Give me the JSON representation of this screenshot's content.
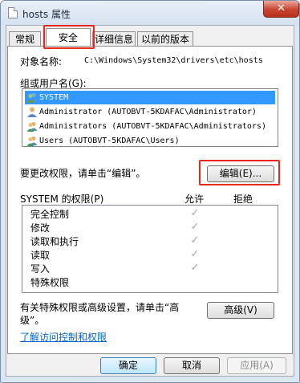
{
  "window": {
    "title": "hosts 属性",
    "close_glyph": "✕"
  },
  "tabs": [
    {
      "label": "常规"
    },
    {
      "label": "安全"
    },
    {
      "label": "详细信息"
    },
    {
      "label": "以前的版本"
    }
  ],
  "object": {
    "label": "对象名称:",
    "value": "C:\\Windows\\System32\\drivers\\etc\\hosts"
  },
  "groups": {
    "label": "组或用户名(G):",
    "items": [
      {
        "name": "SYSTEM",
        "icon": "user-group-icon",
        "selected": true
      },
      {
        "name": "Administrator (AUTOBVT-5KDAFAC\\Administrator)",
        "icon": "user-icon",
        "selected": false
      },
      {
        "name": "Administrators (AUTOBVT-5KDAFAC\\Administrators)",
        "icon": "user-group-icon",
        "selected": false
      },
      {
        "name": "Users (AUTOBVT-5KDAFAC\\Users)",
        "icon": "user-group-icon",
        "selected": false
      }
    ]
  },
  "change_hint": "要更改权限，请单击“编辑”。",
  "edit_button": "编辑(E)...",
  "permissions": {
    "label": "SYSTEM 的权限(P)",
    "allow_header": "允许",
    "deny_header": "拒绝",
    "rows": [
      {
        "name": "完全控制",
        "allow": true,
        "deny": false
      },
      {
        "name": "修改",
        "allow": true,
        "deny": false
      },
      {
        "name": "读取和执行",
        "allow": true,
        "deny": false
      },
      {
        "name": "读取",
        "allow": true,
        "deny": false
      },
      {
        "name": "写入",
        "allow": true,
        "deny": false
      },
      {
        "name": "特殊权限",
        "allow": false,
        "deny": false
      }
    ],
    "check_glyph": "✓"
  },
  "advanced_hint_line1": "有关特殊权限或高级设置，请单击“高",
  "advanced_hint_line2": "级”。",
  "advanced_button": "高级(V)",
  "learn_link": "了解访问控制和权限",
  "footer": {
    "ok": "确定",
    "cancel": "取消",
    "apply": "应用(A)"
  },
  "colors": {
    "selection": "#3399ff",
    "highlight_box": "#e8281c",
    "link": "#0066cc"
  }
}
